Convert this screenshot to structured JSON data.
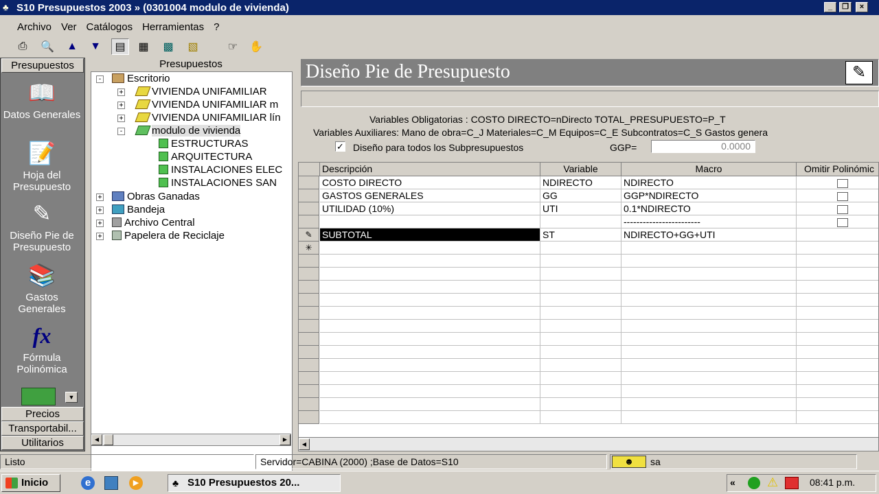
{
  "window": {
    "title": "S10 Presupuestos 2003 » (0301004 modulo de vivienda)"
  },
  "menu": [
    "Archivo",
    "Ver",
    "Catálogos",
    "Herramientas",
    "?"
  ],
  "left_bar": {
    "header": "Presupuestos",
    "items": [
      "Datos Generales",
      "Hoja del Presupuesto",
      "Diseño Pie de Presupuesto",
      "Gastos Generales",
      "Fórmula Polinómica"
    ],
    "footer": [
      "Precios",
      "Transportabil...",
      "Utilitarios"
    ]
  },
  "tree": {
    "header": "Presupuestos",
    "root": "Escritorio",
    "items": [
      "VIVIENDA UNIFAMILIAR",
      "VIVIENDA UNIFAMILIAR m",
      "VIVIENDA UNIFAMILIAR lín",
      "modulo de vivienda"
    ],
    "subitems": [
      "ESTRUCTURAS",
      "ARQUITECTURA",
      "INSTALACIONES ELEC",
      "INSTALACIONES SAN"
    ],
    "others": [
      "Obras Ganadas",
      "Bandeja",
      "Archivo Central",
      "Papelera de Reciclaje"
    ]
  },
  "design": {
    "title": "Diseño Pie de Presupuesto",
    "vars_oblig": "Variables Obligatorias : COSTO DIRECTO=nDirecto     TOTAL_PRESUPUESTO=P_T",
    "vars_aux": "Variables Auxiliares: Mano de obra=C_J  Materiales=C_M  Equipos=C_E  Subcontratos=C_S  Gastos genera",
    "checkbox_label": "Diseño para todos los Subpresupuestos",
    "ggp_label": "GGP=",
    "ggp_value": "0.0000"
  },
  "grid": {
    "columns": [
      "Descripción",
      "Variable",
      "Macro",
      "Omitir Polinómic"
    ],
    "rows": [
      {
        "desc": "COSTO DIRECTO",
        "var": "NDIRECTO",
        "macro": "NDIRECTO"
      },
      {
        "desc": "GASTOS GENERALES",
        "var": "GG",
        "macro": "GGP*NDIRECTO"
      },
      {
        "desc": "UTILIDAD (10%)",
        "var": "UTI",
        "macro": "0.1*NDIRECTO"
      },
      {
        "desc": "",
        "var": "",
        "macro": "------------------------"
      },
      {
        "desc": "SUBTOTAL",
        "var": "ST",
        "macro": "NDIRECTO+GG+UTI"
      }
    ]
  },
  "status": {
    "left": "Listo",
    "server": "Servidor=CABINA (2000) ;Base de Datos=S10",
    "user": "sa"
  },
  "taskbar": {
    "start": "Inicio",
    "task": "S10 Presupuestos 20...",
    "clock": "08:41 p.m."
  },
  "colors": {
    "title_bar": "#0a246a",
    "selected_cell": "#000000",
    "sidebar": "#808080"
  }
}
